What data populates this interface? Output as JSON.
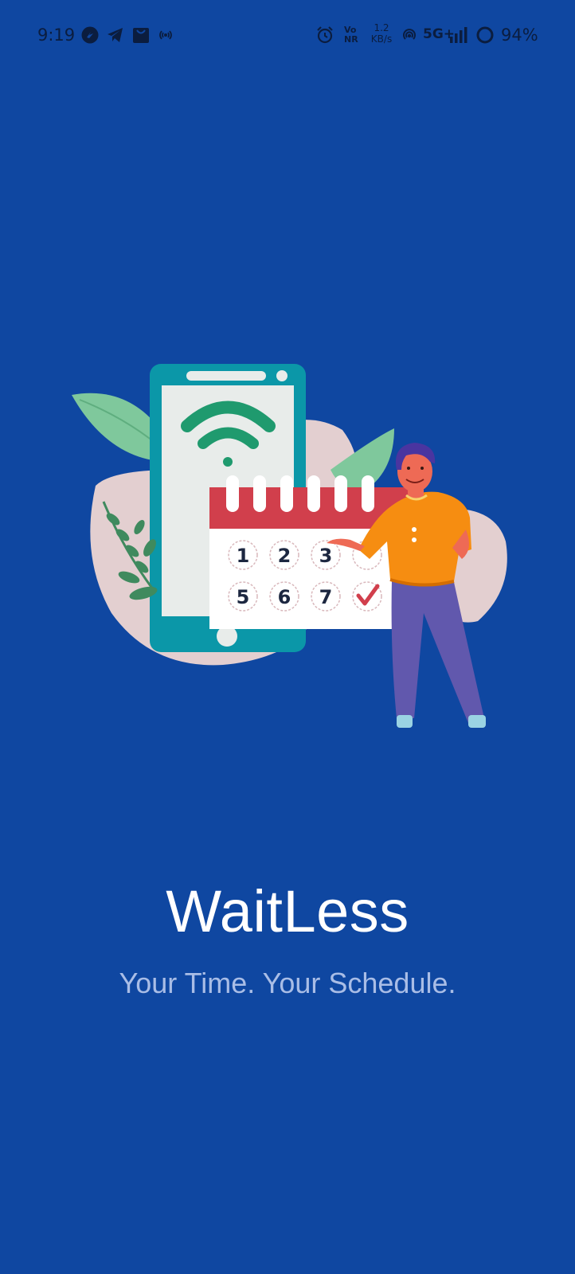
{
  "status_bar": {
    "time": "9:19",
    "net_speed_value": "1.2",
    "net_speed_unit": "KB/s",
    "volte_top": "Vo",
    "volte_bottom": "NR",
    "network_type": "5G+",
    "battery_percent": "94%",
    "icons": [
      "whatsapp-icon",
      "telegram-icon",
      "shopping-bag-icon",
      "hotspot-icon",
      "alarm-icon",
      "wifi-calling-icon",
      "signal-icon",
      "battery-ring-icon"
    ]
  },
  "splash": {
    "app_name": "WaitLess",
    "tagline": "Your Time. Your Schedule.",
    "illustration": {
      "calendar_numbers": [
        "1",
        "2",
        "3",
        "5",
        "6",
        "7"
      ],
      "icons": [
        "phone-icon",
        "wifi-icon",
        "calendar-icon",
        "checkmark-icon",
        "person-icon",
        "leaf-icon"
      ]
    }
  },
  "colors": {
    "background": "#0f47a1",
    "title": "#ffffff",
    "tagline": "#a9bde6",
    "status_text": "#0b1d3f",
    "calendar_header": "#d13f4c",
    "phone_frame": "#0b97a8",
    "shirt": "#f68d11",
    "pants": "#6158ad"
  }
}
